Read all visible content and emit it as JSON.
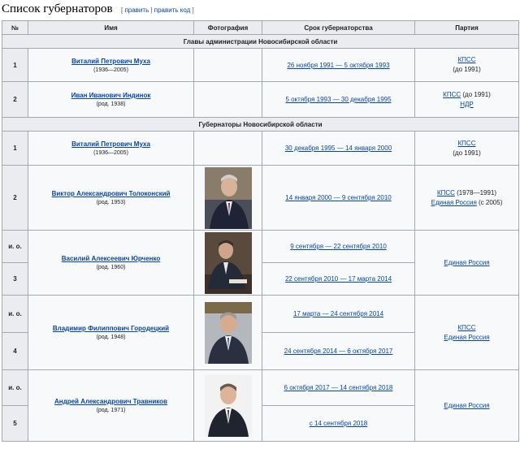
{
  "heading": {
    "title": "Список губернаторов",
    "edit": "править",
    "edit_code": "править код"
  },
  "table": {
    "columns": [
      "№",
      "Имя",
      "Фотография",
      "Срок губернаторства",
      "Партия"
    ],
    "section1": "Главы администрации Новосибирской области",
    "section2": "Губернаторы Новосибирской области",
    "rows": [
      {
        "num": "1",
        "name": "Виталий Петрович Муха",
        "years": "(1936—2005)",
        "term": "26 ноября 1991 — 5 октября 1993",
        "party1": "КПСС",
        "party1_note": "(до 1991)"
      },
      {
        "num": "2",
        "name": "Иван Иванович Индинок",
        "years": "(род. 1938)",
        "term": "5 октября 1993 — 30 декабря 1995",
        "party1": "КПСС",
        "party1_note": " (до 1991)",
        "party2": "НДР"
      },
      {
        "num": "1",
        "name": "Виталий Петрович Муха",
        "years": "(1936—2005)",
        "term": "30 декабря 1995 — 14 января 2000",
        "party1": "КПСС",
        "party1_note": "(до 1991)"
      },
      {
        "num": "2",
        "name": "Виктор Александрович Толоконский",
        "years": "(род. 1953)",
        "term": "14 января 2000 — 9 сентября 2010",
        "party1": "КПСС",
        "party1_note": " (1978—1991)",
        "party2": "Единая Россия",
        "party2_note": " (с 2005)"
      },
      {
        "num_a": "и. о.",
        "num_b": "3",
        "name": "Василий Алексеевич Юрченко",
        "years": "(род. 1960)",
        "term_a": "9 сентября — 22 сентября 2010",
        "term_b": "22 сентября 2010 — 17 марта 2014",
        "party1": "Единая Россия"
      },
      {
        "num_a": "и. о.",
        "num_b": "4",
        "name": "Владимир Филиппович Городецкий",
        "years": "(род. 1948)",
        "term_a": "17 марта — 24 сентября 2014",
        "term_b": "24 сентября 2014 — 6 октября 2017",
        "party1": "КПСС",
        "party2": "Единая Россия"
      },
      {
        "num_a": "и. о.",
        "num_b": "5",
        "name": "Андрей Александрович Травников",
        "years": "(род. 1971)",
        "term_a": "6 октября 2017 — 14 сентября 2018",
        "term_b": "с 14 сентября 2018",
        "party1": "Единая Россия"
      }
    ]
  }
}
